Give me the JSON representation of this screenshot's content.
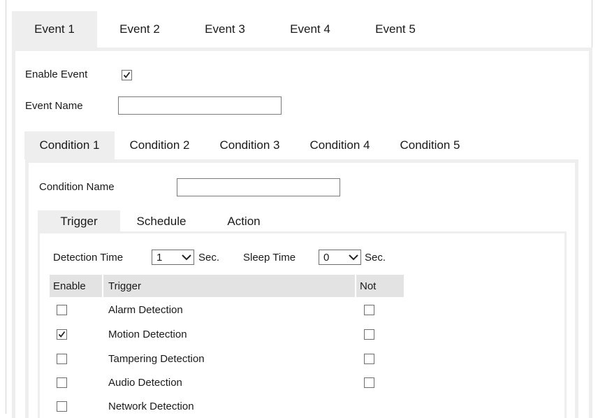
{
  "event_tabs": [
    "Event 1",
    "Event 2",
    "Event 3",
    "Event 4",
    "Event 5"
  ],
  "event_form": {
    "enable_label": "Enable Event",
    "enable_checked": true,
    "name_label": "Event Name",
    "name_value": ""
  },
  "condition_tabs": [
    "Condition 1",
    "Condition 2",
    "Condition 3",
    "Condition 4",
    "Condition 5"
  ],
  "condition_form": {
    "name_label": "Condition Name",
    "name_value": ""
  },
  "sub_tabs": [
    "Trigger",
    "Schedule",
    "Action"
  ],
  "trigger": {
    "detection_time_label": "Detection Time",
    "detection_time_value": "1",
    "detection_unit": "Sec.",
    "sleep_time_label": "Sleep Time",
    "sleep_time_value": "0",
    "sleep_unit": "Sec."
  },
  "table": {
    "headers": [
      "Enable",
      "Trigger",
      "Not"
    ],
    "rows": [
      {
        "label": "Alarm Detection",
        "enabled": false,
        "not": false
      },
      {
        "label": "Motion Detection",
        "enabled": true,
        "not": false
      },
      {
        "label": "Tampering Detection",
        "enabled": false,
        "not": false
      },
      {
        "label": "Audio Detection",
        "enabled": false,
        "not": false
      },
      {
        "label": "Network Detection",
        "enabled": false,
        "not": null
      }
    ]
  }
}
